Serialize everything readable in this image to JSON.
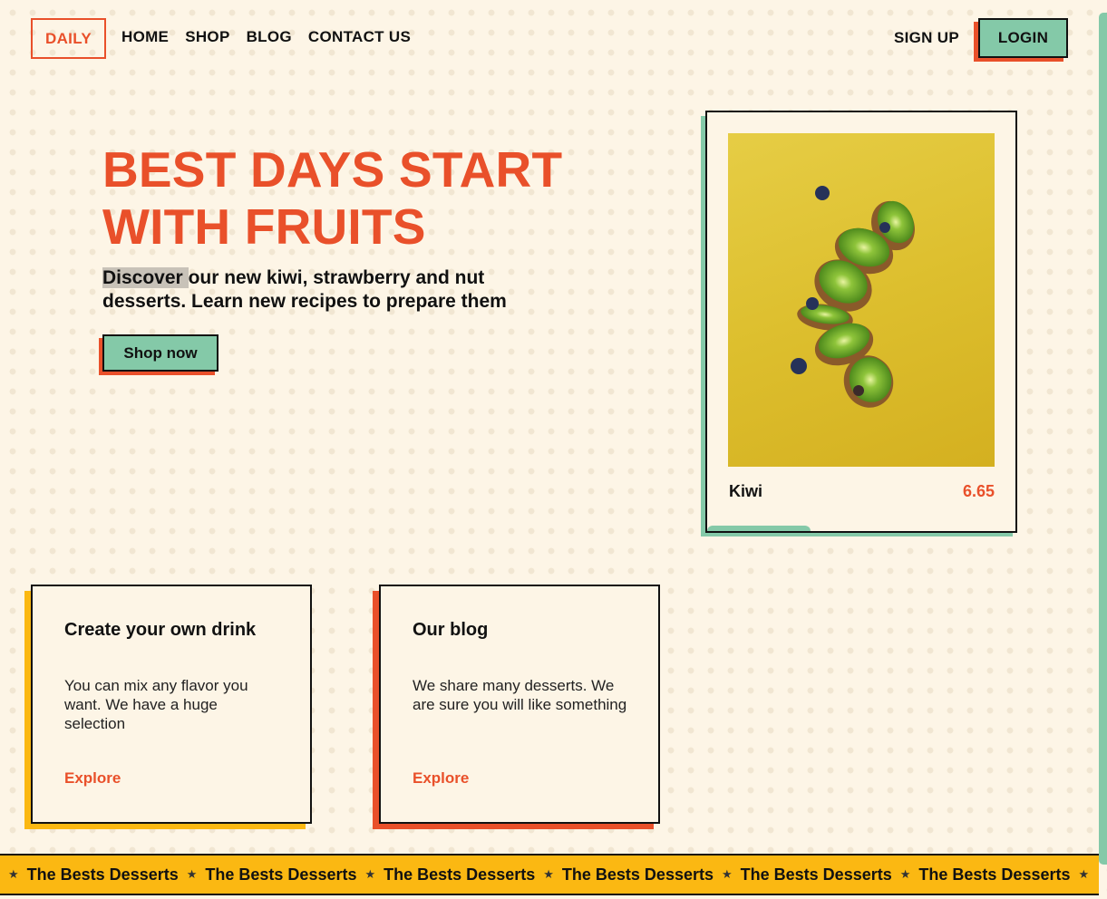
{
  "nav": {
    "logo": "DAILY",
    "links": [
      "HOME",
      "SHOP",
      "BLOG",
      "CONTACT US"
    ],
    "signup": "SIGN UP",
    "login": "LOGIN"
  },
  "hero": {
    "title_line1": "BEST DAYS START",
    "title_line2": "WITH FRUITS",
    "subtitle_highlight": "Discover ",
    "subtitle_rest": "our new kiwi, strawberry and nut desserts. Learn new recipes to prepare them",
    "cta": "Shop now"
  },
  "product": {
    "name": "Kiwi",
    "price": "6.65",
    "image_icon": "kiwi-slices-image"
  },
  "features": [
    {
      "title": "Create your own drink",
      "text": "You can mix any flavor you want. We have a huge selection",
      "link": "Explore"
    },
    {
      "title": "Our blog",
      "text": "We share many desserts. We are sure you will like something",
      "link": "Explore"
    }
  ],
  "marquee": {
    "text": "The Bests Desserts",
    "separator": "★"
  },
  "colors": {
    "accent": "#e9502a",
    "mint": "#84c9a8",
    "yellow": "#fbb812",
    "background": "#fdf5e6"
  }
}
